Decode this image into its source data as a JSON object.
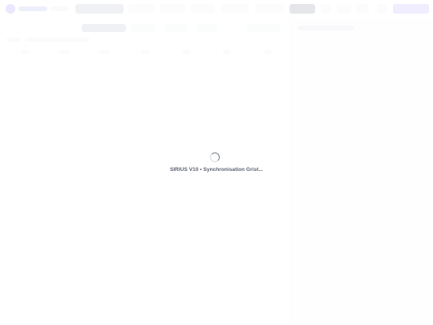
{
  "loading": {
    "message": "SIRIUS V10 • Synchronisation Grist..."
  },
  "colors": {
    "brand": "#6d5ef5",
    "accent_button": "#8f86f7",
    "side_panel_bg": "#f3f4f7",
    "spinner_active": "#7a8091",
    "text": "#5b6070"
  },
  "icons": {
    "logo": "sirius-logo-icon",
    "spinner": "loading-spinner-icon"
  }
}
